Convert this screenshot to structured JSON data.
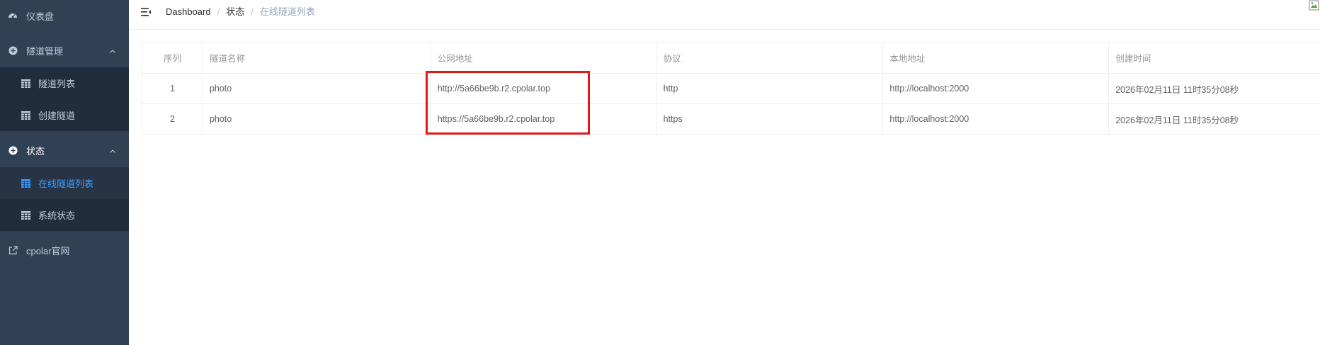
{
  "sidebar": {
    "items": [
      {
        "label": "仪表盘",
        "icon": "dashboard-icon"
      },
      {
        "label": "隧道管理",
        "icon": "plus-circle-icon"
      },
      {
        "label": "隧道列表",
        "icon": "grid-icon"
      },
      {
        "label": "创建隧道",
        "icon": "grid-icon"
      },
      {
        "label": "状态",
        "icon": "plus-circle-icon"
      },
      {
        "label": "在线隧道列表",
        "icon": "grid-icon"
      },
      {
        "label": "系统状态",
        "icon": "grid-icon"
      },
      {
        "label": "cpolar官网",
        "icon": "external-link-icon"
      }
    ]
  },
  "breadcrumb": [
    "Dashboard",
    "状态",
    "在线隧道列表"
  ],
  "table": {
    "headers": [
      "序列",
      "隧道名称",
      "公网地址",
      "协议",
      "本地地址",
      "创建时间"
    ],
    "rows": [
      [
        "1",
        "photo",
        "http://5a66be9b.r2.cpolar.top",
        "http",
        "http://localhost:2000",
        "2026年02月11日 11时35分08秒"
      ],
      [
        "2",
        "photo",
        "https://5a66be9b.r2.cpolar.top",
        "https",
        "http://localhost:2000",
        "2026年02月11日 11时35分08秒"
      ]
    ]
  },
  "colors": {
    "sidebar_bg": "#304156",
    "submenu_bg": "#1f2d3d",
    "active_text": "#409eff",
    "highlight_border": "#e11818"
  }
}
